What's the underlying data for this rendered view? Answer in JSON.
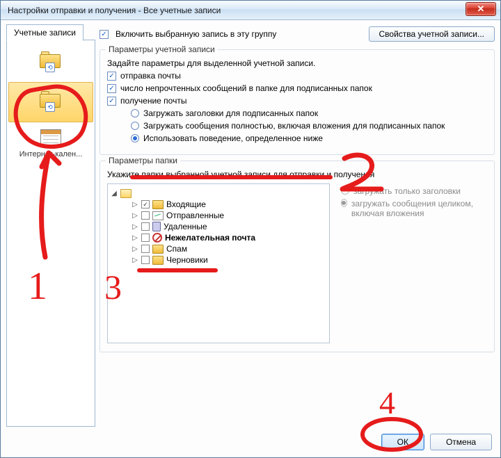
{
  "titlebar": {
    "title": "Настройки отправки и получения - Все учетные записи"
  },
  "tab": {
    "label": "Учетные записи"
  },
  "sidebar": {
    "accounts": [
      {
        "label": ""
      },
      {
        "label": ""
      },
      {
        "label": "Интернет-кален..."
      }
    ]
  },
  "top": {
    "include_label": "Включить выбранную запись в эту группу",
    "include_checked": true,
    "properties_btn": "Свойства учетной записи..."
  },
  "acct_group": {
    "legend": "Параметры учетной записи",
    "instruction": "Задайте параметры для выделенной учетной записи.",
    "send_label": "отправка почты",
    "send_checked": true,
    "unread_label": "число непрочтенных сообщений в папке для подписанных папок",
    "unread_checked": true,
    "recv_label": "получение почты",
    "recv_checked": true,
    "r1": "Загружать заголовки для подписанных папок",
    "r2": "Загружать сообщения полностью, включая вложения для подписанных папок",
    "r3": "Использовать поведение, определенное ниже",
    "radio_selected": 3
  },
  "folder_group": {
    "legend": "Параметры папки",
    "instruction": "Укажите папки выбранной учетной записи для отправки и получения",
    "tree": {
      "root_label": "",
      "items": [
        {
          "label": "Входящие",
          "checked": true,
          "icon": "folder",
          "bold": false
        },
        {
          "label": "Отправленные",
          "checked": false,
          "icon": "sent",
          "bold": false
        },
        {
          "label": "Удаленные",
          "checked": false,
          "icon": "trash",
          "bold": false
        },
        {
          "label": "Нежелательная почта",
          "checked": false,
          "icon": "junk",
          "bold": true
        },
        {
          "label": "Спам",
          "checked": false,
          "icon": "folder",
          "bold": false
        },
        {
          "label": "Черновики",
          "checked": false,
          "icon": "folder",
          "bold": false
        }
      ]
    },
    "opt_headers": "загружать только заголовки",
    "opt_full": "загружать сообщения целиком, включая вложения"
  },
  "buttons": {
    "ok": "ОК",
    "cancel": "Отмена"
  },
  "annotations": {
    "n1": "1",
    "n2": "2",
    "n3": "3",
    "n4": "4"
  }
}
